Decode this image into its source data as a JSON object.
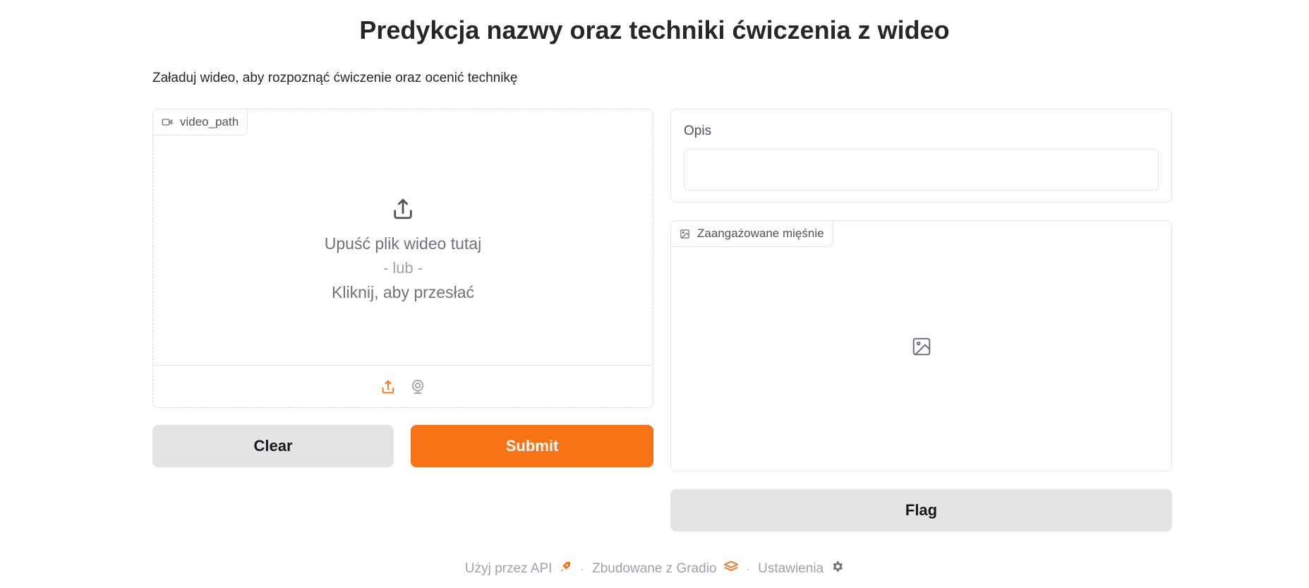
{
  "page": {
    "title": "Predykcja nazwy oraz techniki ćwiczenia z wideo",
    "description": "Załaduj wideo, aby rozpoznąć ćwiczenie oraz ocenić technikę"
  },
  "video_input": {
    "label": "video_path",
    "label_icon": "video-camera-icon",
    "drop_text": "Upuść plik wideo tutaj",
    "or_text": "- lub -",
    "click_text": "Kliknij, aby przesłać",
    "sources": [
      "upload-icon",
      "webcam-icon"
    ],
    "active_source": "upload"
  },
  "buttons": {
    "clear": "Clear",
    "submit": "Submit",
    "flag": "Flag"
  },
  "output_text": {
    "label": "Opis",
    "value": ""
  },
  "output_image": {
    "label": "Zaangażowane mięśnie",
    "label_icon": "image-icon"
  },
  "footer": {
    "api": "Użyj przez API",
    "built_with": "Zbudowane z Gradio",
    "settings": "Ustawienia",
    "separator": "·"
  },
  "colors": {
    "accent": "#f97316",
    "secondary_button": "#e4e4e7",
    "border": "#e4e4e7",
    "muted_text": "#71717a"
  }
}
